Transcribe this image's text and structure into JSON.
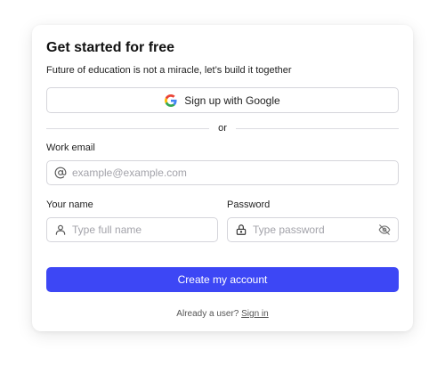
{
  "card": {
    "title": "Get started for free",
    "subtitle": "Future of education is not a miracle, let’s build it together"
  },
  "google": {
    "label": "Sign up with Google",
    "icon": "google-g-icon"
  },
  "divider": {
    "text": "or"
  },
  "email": {
    "label": "Work email",
    "placeholder": "example@example.com",
    "value": "",
    "icon": "at-sign-icon"
  },
  "name": {
    "label": "Your name",
    "placeholder": "Type full name",
    "value": "",
    "icon": "user-icon"
  },
  "password": {
    "label": "Password",
    "placeholder": "Type password",
    "value": "",
    "icon": "lock-icon",
    "toggle_icon": "eye-off-icon"
  },
  "submit": {
    "label": "Create my account"
  },
  "footer": {
    "prompt": "Already a user?",
    "link": "Sign in"
  },
  "colors": {
    "primary": "#3d47f5",
    "border": "#d5d5db",
    "placeholder": "#a3a3aa"
  }
}
